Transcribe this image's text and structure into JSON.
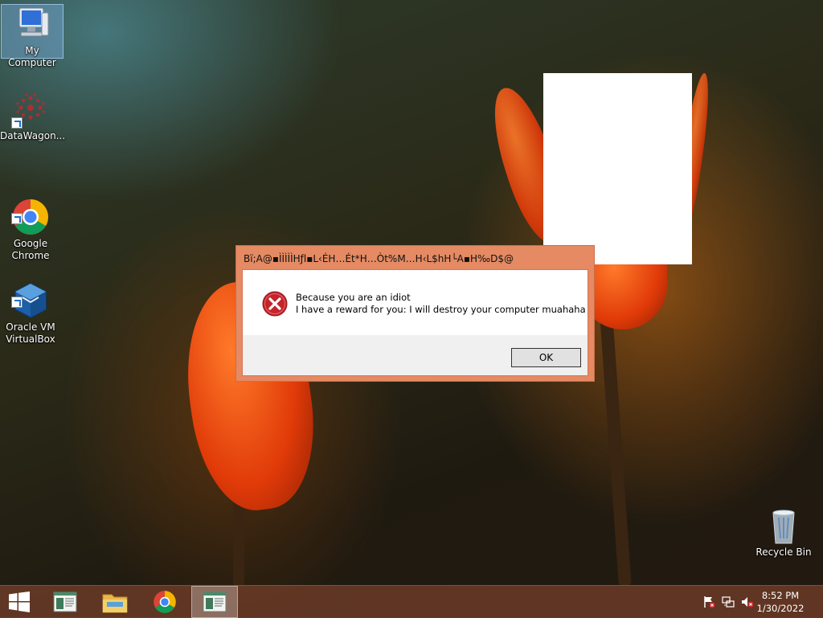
{
  "desktop": {
    "icons": [
      {
        "label": "My Computer"
      },
      {
        "label": "DataWagon..."
      },
      {
        "label": "Google\nChrome"
      },
      {
        "label": "Oracle VM\nVirtualBox"
      },
      {
        "label": "Recycle Bin"
      }
    ]
  },
  "dialog": {
    "title": "Bï;A@▪ÌÌÌÌÌHƒl▪L‹ÉH…Ét*H…Òt%M…H‹L$hH└A▪H‰D$@",
    "message_line1": "Because you are an idiot",
    "message_line2": "I have a reward for you: I will destroy your computer muahaha",
    "ok_label": "OK",
    "icon": "error-icon"
  },
  "taskbar": {
    "items": [
      "start-icon",
      "app-window-icon",
      "file-explorer-icon",
      "chrome-icon",
      "app-window-icon"
    ],
    "tray": [
      "action-center-flag-icon",
      "network-icon",
      "volume-muted-icon"
    ],
    "time": "8:52 PM",
    "date": "1/30/2022"
  },
  "colors": {
    "dialog_frame": "#e58a63",
    "taskbar": "#6e3c28"
  }
}
